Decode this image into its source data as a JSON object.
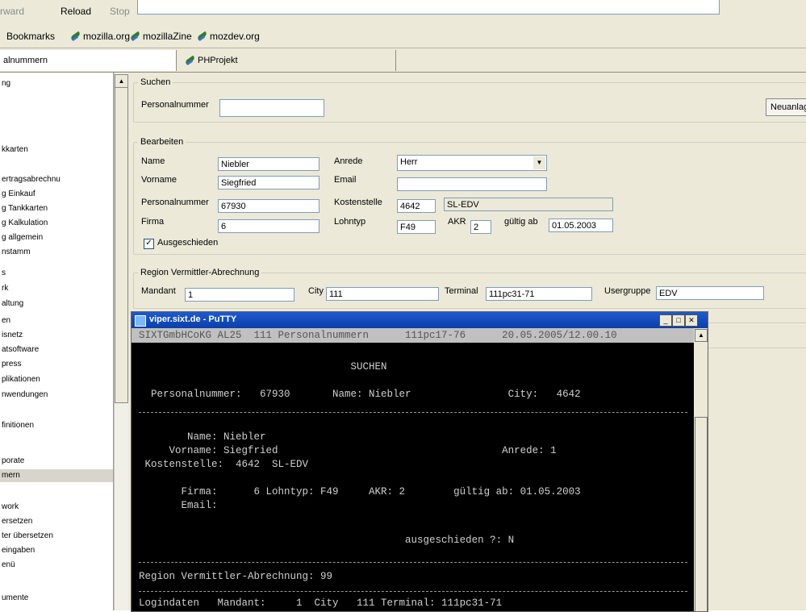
{
  "browser": {
    "nav": {
      "forward": "rward",
      "reload": "Reload",
      "stop": "Stop"
    },
    "bookmarks": {
      "label": "Bookmarks",
      "items": [
        "mozilla.org",
        "mozillaZine",
        "mozdev.org"
      ]
    },
    "tabs": [
      "alnummern",
      "PHProjekt"
    ]
  },
  "sidebar": {
    "items": [
      "ng",
      "kkarten",
      "ertragsabrechnu",
      "g Einkauf",
      "g Tankkarten",
      "g Kalkulation",
      "g allgemein",
      "nstamm",
      "s",
      "rk",
      "altung",
      "en",
      "isnetz",
      "atsoftware",
      "press",
      "plikationen",
      "nwendungen",
      "finitionen",
      "porate",
      "mern",
      "work",
      "ersetzen",
      "ter übersetzen",
      "eingaben",
      "enü",
      "umente"
    ]
  },
  "form": {
    "suchen": {
      "legend": "Suchen",
      "personalnummer_label": "Personalnummer",
      "personalnummer_value": "",
      "neuanlage_button": "Neuanlag"
    },
    "bearbeiten": {
      "legend": "Bearbeiten",
      "name_label": "Name",
      "name_value": "Niebler",
      "vorname_label": "Vorname",
      "vorname_value": "Siegfried",
      "personalnummer_label": "Personalnummer",
      "personalnummer_value": "67930",
      "firma_label": "Firma",
      "firma_value": "6",
      "anrede_label": "Anrede",
      "anrede_value": "Herr",
      "email_label": "Email",
      "email_value": "",
      "kostenstelle_label": "Kostenstelle",
      "kostenstelle_value": "4642",
      "kostenstelle_name": "SL-EDV",
      "lohntyp_label": "Lohntyp",
      "lohntyp_value": "F49",
      "akr_label": "AKR",
      "akr_value": "2",
      "gueltig_label": "gültig ab",
      "gueltig_value": "01.05.2003",
      "ausgeschieden_label": "Ausgeschieden",
      "ausgeschieden_checked": true
    },
    "region": {
      "legend": "Region Vermittler-Abrechnung",
      "mandant_label": "Mandant",
      "mandant_value": "1",
      "city_label": "City",
      "city_value": "111",
      "terminal_label": "Terminal",
      "terminal_value": "111pc31-71",
      "usergruppe_label": "Usergruppe",
      "usergruppe_value": "EDV"
    }
  },
  "putty": {
    "title": "viper.sixt.de - PuTTY",
    "header_line": "SIXTGmbHCoKG AL25  111 Personalnummern      111pc17-76      20.05.2005/12.00.10",
    "lines": [
      "                                   SUCHEN",
      "  Personalnummer:   67930       Name: Niebler                City:   4642",
      "        Name: Niebler",
      "     Vorname: Siegfried                                     Anrede: 1",
      " Kostenstelle:  4642  SL-EDV",
      "       Firma:      6 Lohntyp: F49     AKR: 2        gültig ab: 01.05.2003",
      "       Email:",
      "                                            ausgeschieden ?: N",
      "Region Vermittler-Abrechnung: 99",
      "Logindaten   Mandant:     1  City   111 Terminal: 111pc31-71"
    ]
  }
}
